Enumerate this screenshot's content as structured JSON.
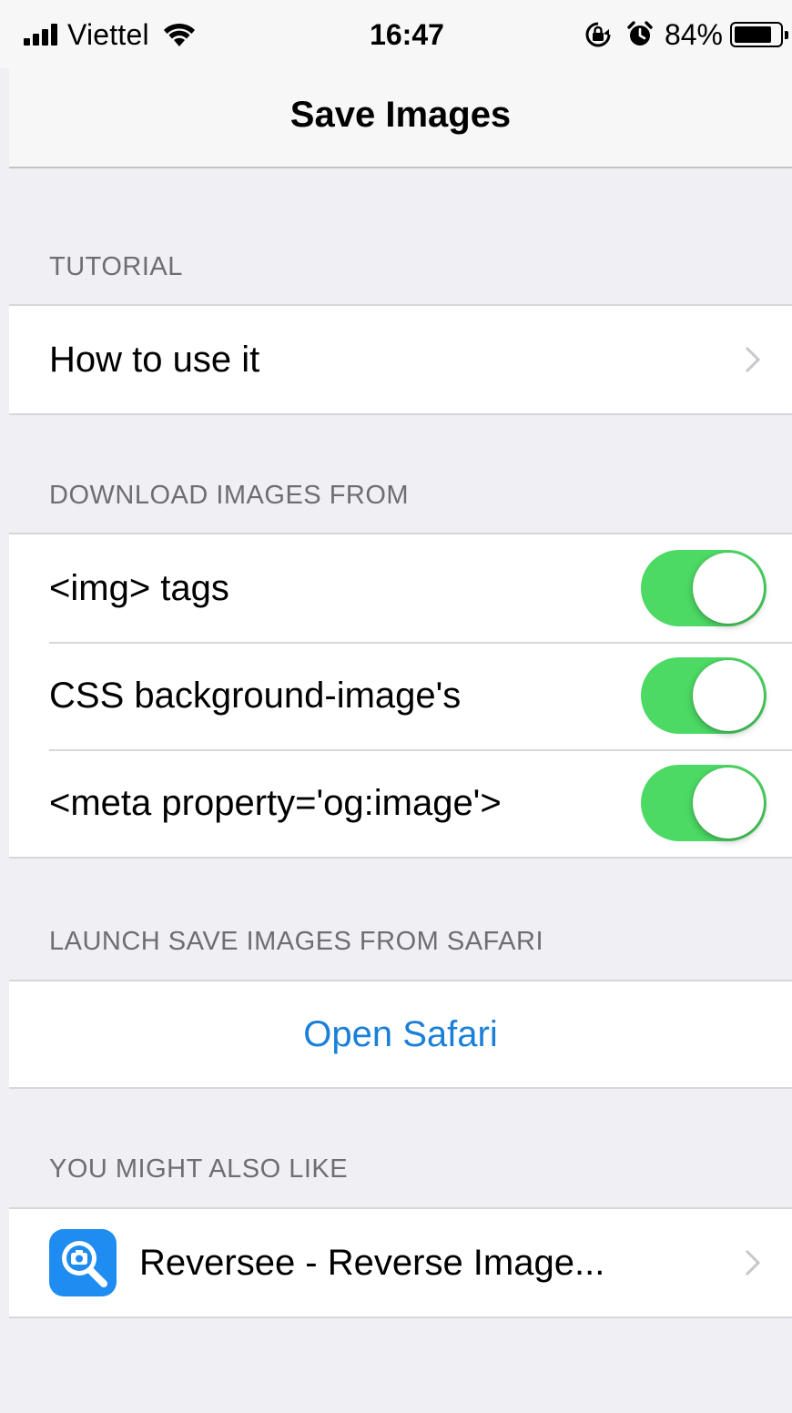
{
  "status_bar": {
    "carrier": "Viettel",
    "time": "16:47",
    "battery_percent": "84%",
    "battery_level": 0.84,
    "icons": [
      "signal-icon",
      "wifi-icon",
      "orientation-lock-icon",
      "alarm-icon",
      "battery-icon"
    ]
  },
  "nav": {
    "title": "Save Images"
  },
  "sections": {
    "tutorial": {
      "header": "TUTORIAL",
      "rows": [
        {
          "label": "How to use it",
          "accessory": "chevron-right-icon"
        }
      ]
    },
    "download": {
      "header": "DOWNLOAD IMAGES FROM",
      "rows": [
        {
          "label": "<img> tags",
          "toggle_on": true
        },
        {
          "label": "CSS background-image's",
          "toggle_on": true
        },
        {
          "label": "<meta property='og:image'>",
          "toggle_on": true
        }
      ]
    },
    "launch": {
      "header": "LAUNCH SAVE IMAGES FROM SAFARI",
      "action": "Open Safari"
    },
    "also_like": {
      "header": "YOU MIGHT ALSO LIKE",
      "rows": [
        {
          "label": "Reversee - Reverse Image...",
          "icon": "reversee-app-icon",
          "accessory": "chevron-right-icon"
        }
      ]
    }
  },
  "colors": {
    "toggle_on": "#4cd964",
    "link_blue": "#1a7fd8",
    "background": "#efeff4",
    "header_text": "#6d6d72",
    "app_icon_blue": "#1e8cf0"
  }
}
